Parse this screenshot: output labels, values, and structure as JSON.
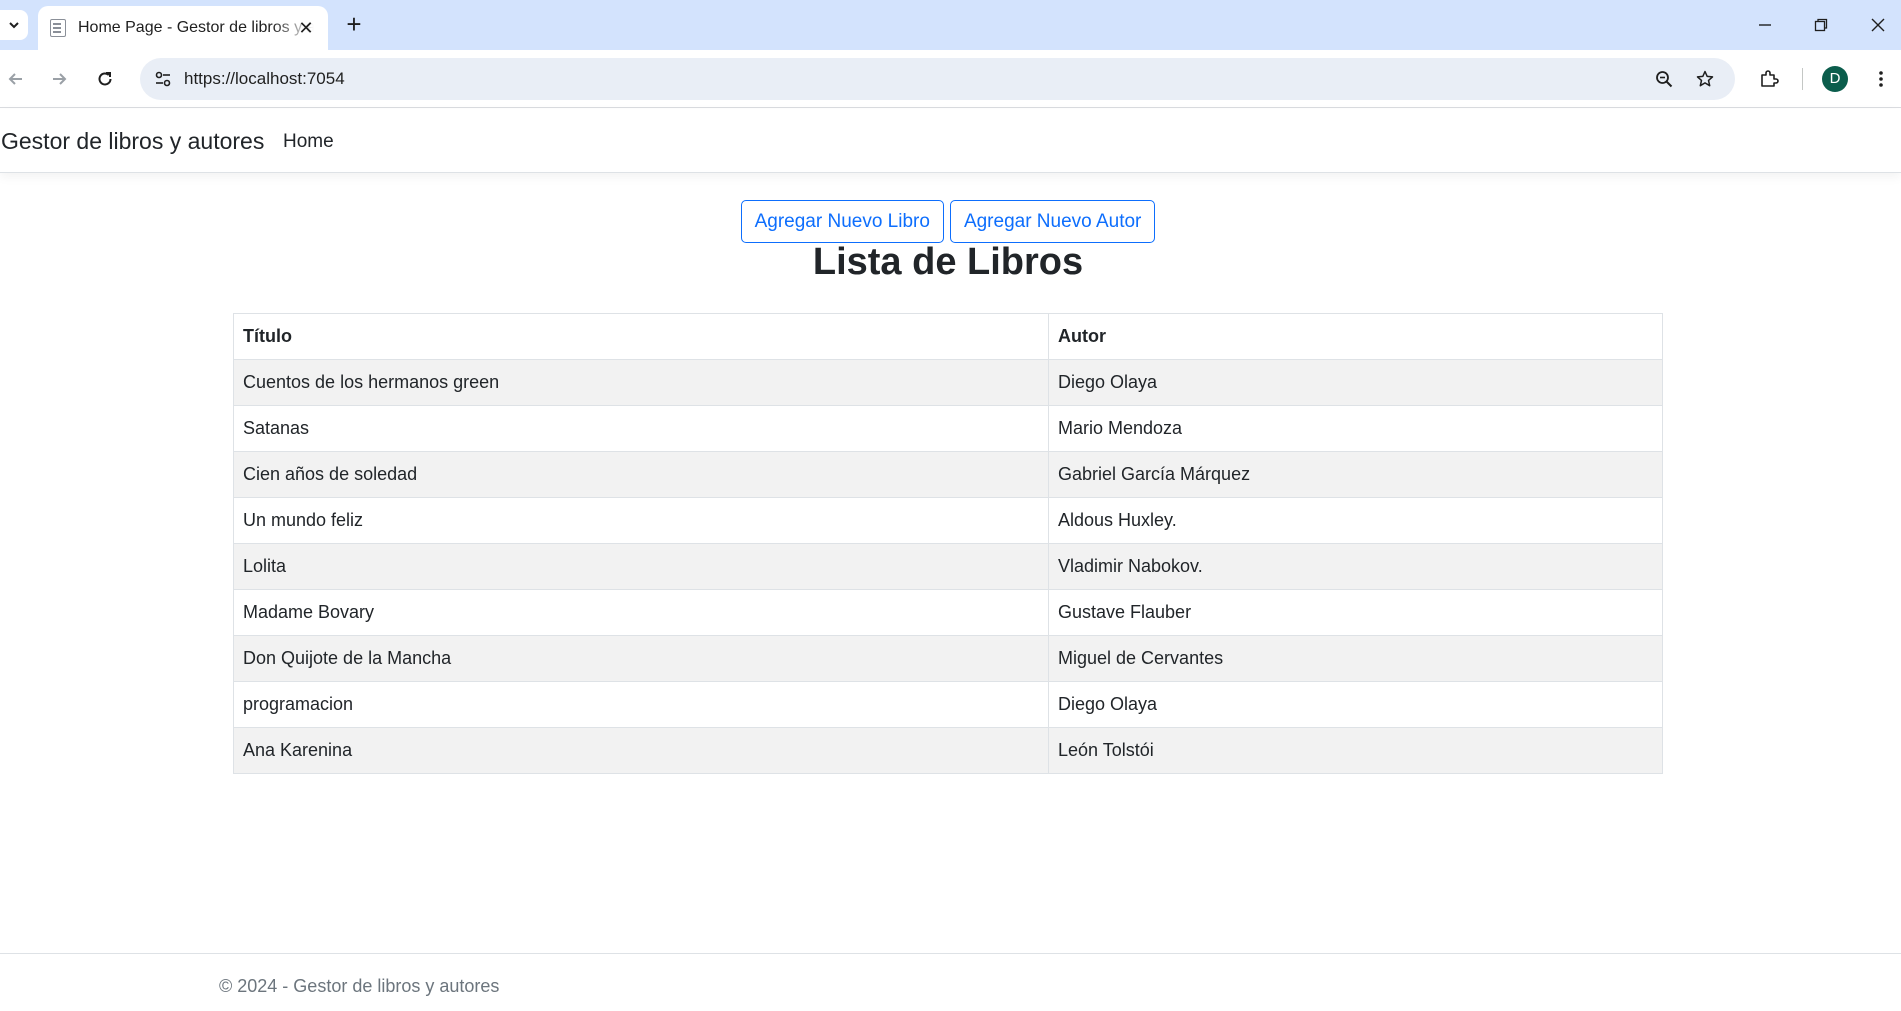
{
  "browser": {
    "tab_title": "Home Page - Gestor de libros y autores",
    "url": "https://localhost:7054",
    "profile_initial": "D"
  },
  "navbar": {
    "brand": "Gestor de libros y autores",
    "home_link": "Home"
  },
  "actions": {
    "add_book": "Agregar Nuevo Libro",
    "add_author": "Agregar Nuevo Autor"
  },
  "main": {
    "title": "Lista de Libros"
  },
  "table": {
    "headers": [
      "Título",
      "Autor"
    ],
    "rows": [
      {
        "titulo": "Cuentos de los hermanos green",
        "autor": "Diego Olaya"
      },
      {
        "titulo": "Satanas",
        "autor": "Mario Mendoza"
      },
      {
        "titulo": "Cien años de soledad",
        "autor": "Gabriel García Márquez"
      },
      {
        "titulo": "Un mundo feliz",
        "autor": "Aldous Huxley."
      },
      {
        "titulo": "Lolita",
        "autor": "Vladimir Nabokov."
      },
      {
        "titulo": "Madame Bovary",
        "autor": "Gustave Flauber"
      },
      {
        "titulo": "Don Quijote de la Mancha",
        "autor": "Miguel de Cervantes"
      },
      {
        "titulo": "programacion",
        "autor": "Diego Olaya"
      },
      {
        "titulo": "Ana Karenina",
        "autor": "León Tolstói"
      }
    ]
  },
  "footer": {
    "text": "© 2024 - Gestor de libros y autores"
  },
  "colors": {
    "primary": "#0d6efd",
    "tabstrip": "#d3e3fd",
    "striped_row": "#f2f2f2",
    "profile": "#0b5d4c"
  }
}
